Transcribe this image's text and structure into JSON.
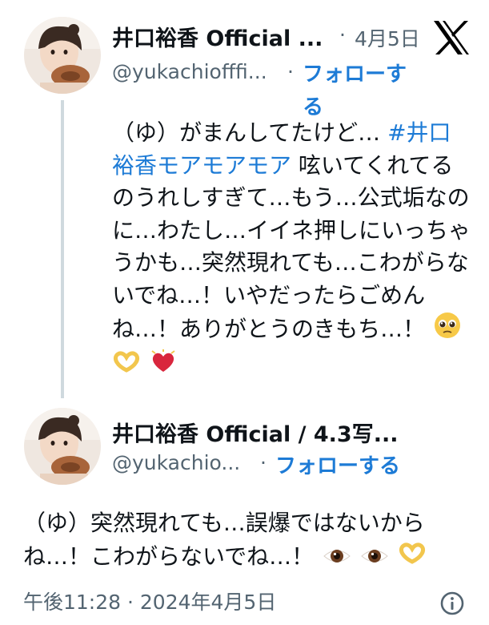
{
  "tweet1": {
    "name": "井口裕香 Official ...",
    "handle": "@yukachiofffi...",
    "separator": "·",
    "date": "4月5日",
    "follow_part1": "フォローす",
    "follow_part2": "る",
    "lines": [
      "（ゆ）がまんしてたけど…",
      "#井口",
      "裕香モアモアモア",
      " 呟いてくれてる",
      "のうれしすぎて…もう…公式垢なの",
      "に…わたし…イイネ押しにいっちゃ",
      "うかも…突然現れても…こわがらな",
      "いでね…！いやだったらごめん",
      "ね…！ありがとうのきもち…！"
    ]
  },
  "tweet2": {
    "name": "井口裕香 Official / 4.3写...",
    "handle": "@yukachio...",
    "separator": "·",
    "follow": "フォローする",
    "lines": [
      "（ゆ）突然現れても…誤爆ではないから",
      "ね…！こわがらないでね…！"
    ]
  },
  "footer": {
    "timestamp": "午後11:28 · 2024年4月5日"
  },
  "icons": {
    "brand": "x-logo",
    "info": "info-icon",
    "emoji_pleading": "pleading-face-emoji",
    "emoji_heart_hands": "heart-hands-emoji",
    "emoji_heart": "beating-heart-emoji",
    "emoji_eye": "eye-emoji"
  },
  "colors": {
    "link": "#1d7bd6",
    "secondary_text": "#536471",
    "thread_line": "#cfd9de"
  }
}
